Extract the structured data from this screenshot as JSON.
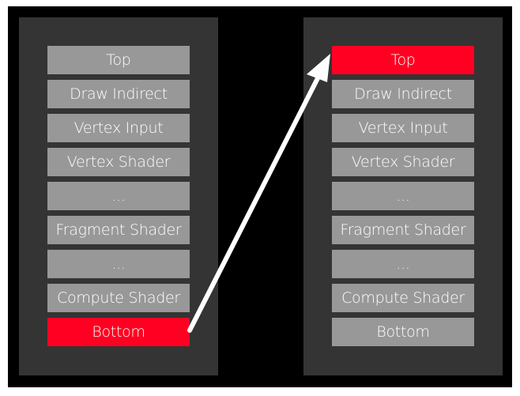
{
  "colors": {
    "background": "#000000",
    "panel": "#343434",
    "stage": "#989898",
    "highlight": "#ff0022",
    "arrow": "#ffffff"
  },
  "left_panel": {
    "stages": [
      "Top",
      "Draw Indirect",
      "Vertex Input",
      "Vertex Shader",
      "...",
      "Fragment Shader",
      "...",
      "Compute Shader",
      "Bottom"
    ],
    "highlighted": "Bottom"
  },
  "right_panel": {
    "stages": [
      "Top",
      "Draw Indirect",
      "Vertex Input",
      "Vertex Shader",
      "...",
      "Fragment Shader",
      "...",
      "Compute Shader",
      "Bottom"
    ],
    "highlighted": "Top"
  },
  "arrow": {
    "from": "left_panel.Bottom",
    "to": "right_panel.Top"
  }
}
